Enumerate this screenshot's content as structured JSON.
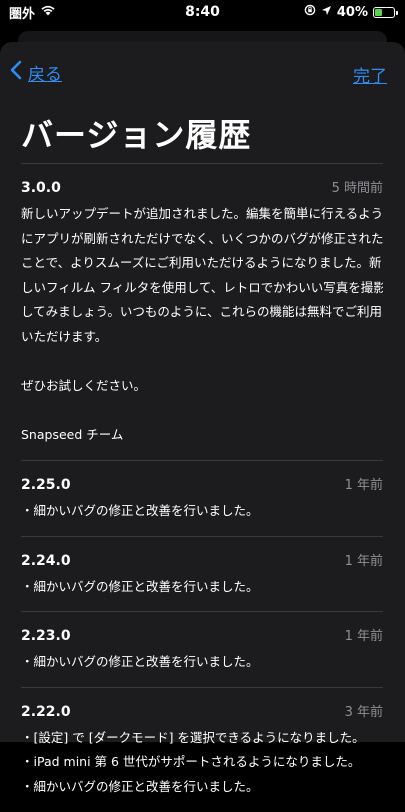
{
  "status": {
    "carrier": "圏外",
    "time": "8:40",
    "battery": "40%",
    "battery_level": 0.4
  },
  "nav": {
    "back_label": "戻る",
    "done_label": "完了"
  },
  "title": "バージョン履歴",
  "entries": [
    {
      "version": "3.0.0",
      "time": "5 時間前",
      "lines": [
        "新しいアップデートが追加されました。編集を簡単に行えるよう",
        "にアプリが刷新されただけでなく、いくつかのバグが修正された",
        "ことで、よりスムーズにご利用いただけるようになりました。新",
        "しいフィルム フィルタを使用して、レトロでかわいい写真を撮影",
        "してみましょう。いつものように、これらの機能は無料でご利用",
        "いただけます。",
        "",
        "ぜひお試しください。",
        "",
        "Snapseed チーム"
      ]
    },
    {
      "version": "2.25.0",
      "time": "1 年前",
      "lines": [
        "・細かいバグの修正と改善を行いました。"
      ]
    },
    {
      "version": "2.24.0",
      "time": "1 年前",
      "lines": [
        "・細かいバグの修正と改善を行いました。"
      ]
    },
    {
      "version": "2.23.0",
      "time": "1 年前",
      "lines": [
        "・細かいバグの修正と改善を行いました。"
      ]
    },
    {
      "version": "2.22.0",
      "time": "3 年前",
      "lines": [
        "・[設定] で [ダークモード] を選択できるようになりました。",
        "・iPad mini 第 6 世代がサポートされるようになりました。",
        "・細かいバグの修正と改善を行いました。"
      ]
    }
  ]
}
